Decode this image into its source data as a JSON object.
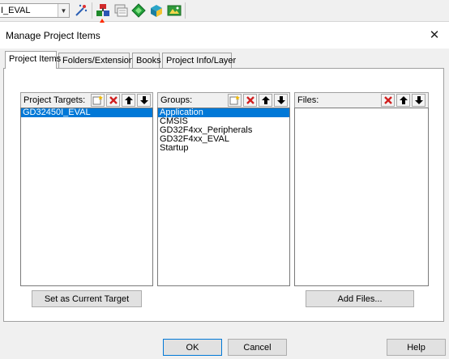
{
  "toolbar": {
    "target_value": "I_EVAL",
    "icons": [
      "dropdown-chevron-icon",
      "magic-wand-icon",
      "manage-project-items-icon",
      "stacked-windows-icon",
      "green-diamond-icon",
      "pack-installer-icon",
      "manage-run-time-environment-icon"
    ]
  },
  "dialog": {
    "title": "Manage Project Items",
    "close": "✕"
  },
  "tabs": [
    {
      "label": "Project Items"
    },
    {
      "label": "Folders/Extensions"
    },
    {
      "label": "Books"
    },
    {
      "label": "Project Info/Layer"
    }
  ],
  "targets": {
    "label": "Project Targets:",
    "items": [
      "GD32450I_EVAL"
    ],
    "selected_index": 0
  },
  "groups": {
    "label": "Groups:",
    "items": [
      "Application",
      "CMSIS",
      "GD32F4xx_Peripherals",
      "GD32F4xx_EVAL",
      "Startup"
    ],
    "selected_index": 0
  },
  "files": {
    "label": "Files:",
    "items": []
  },
  "buttons": {
    "set_current_target": "Set as Current Target",
    "add_files": "Add Files...",
    "ok": "OK",
    "cancel": "Cancel",
    "help": "Help"
  },
  "colors": {
    "selection": "#0078d7",
    "delete_red": "#d02020",
    "annotation_arrow": "#ff2a00"
  }
}
